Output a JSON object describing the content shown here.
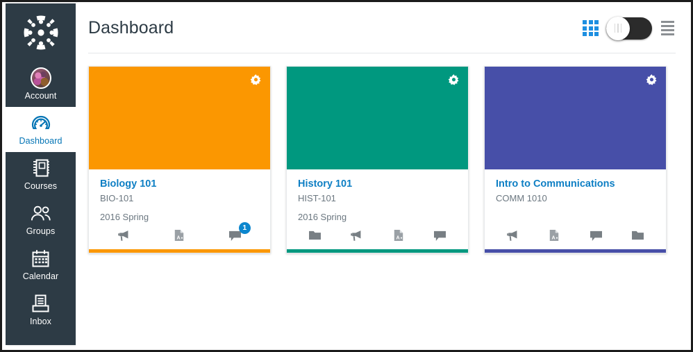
{
  "colors": {
    "nav_background": "#2D3B45",
    "link_blue": "#0E7FC4",
    "grid_icon_blue": "#1D8FE1",
    "badge_blue": "#0B86CE",
    "biology_orange": "#FB9701",
    "history_teal": "#00987F",
    "comm_purple": "#474FA8"
  },
  "global_nav": {
    "logo_icon": "canvas-logo-icon",
    "items": [
      {
        "label": "Account",
        "icon": "avatar-icon",
        "active": false
      },
      {
        "label": "Dashboard",
        "icon": "dashboard-speedometer-icon",
        "active": true
      },
      {
        "label": "Courses",
        "icon": "courses-book-icon",
        "active": false
      },
      {
        "label": "Groups",
        "icon": "groups-people-icon",
        "active": false
      },
      {
        "label": "Calendar",
        "icon": "calendar-icon",
        "active": false
      },
      {
        "label": "Inbox",
        "icon": "inbox-tray-icon",
        "active": false
      }
    ]
  },
  "header": {
    "title": "Dashboard",
    "tools": {
      "grid_view_icon": "grid-view-icon",
      "toggle_icon": "dashboard-view-toggle",
      "list_view_icon": "list-view-icon"
    }
  },
  "cards": [
    {
      "title": "Biology 101",
      "code": "BIO-101",
      "term": "2016 Spring",
      "color": "#FB9701",
      "gear_icon": "gear-icon",
      "links": [
        {
          "icon": "announcements-megaphone-icon",
          "name": "announcements",
          "badge": ""
        },
        {
          "icon": "assignments-page-icon",
          "name": "assignments",
          "badge": ""
        },
        {
          "icon": "discussions-speech-icon",
          "name": "discussions",
          "badge": "1"
        }
      ]
    },
    {
      "title": "History 101",
      "code": "HIST-101",
      "term": "2016 Spring",
      "color": "#00987F",
      "gear_icon": "gear-icon",
      "links": [
        {
          "icon": "files-folder-icon",
          "name": "files",
          "badge": ""
        },
        {
          "icon": "announcements-megaphone-icon",
          "name": "announcements",
          "badge": ""
        },
        {
          "icon": "assignments-page-icon",
          "name": "assignments",
          "badge": ""
        },
        {
          "icon": "discussions-speech-icon",
          "name": "discussions",
          "badge": ""
        }
      ]
    },
    {
      "title": "Intro to Communications",
      "code": "COMM 1010",
      "term": "",
      "color": "#474FA8",
      "gear_icon": "gear-icon",
      "links": [
        {
          "icon": "announcements-megaphone-icon",
          "name": "announcements",
          "badge": ""
        },
        {
          "icon": "assignments-page-icon",
          "name": "assignments",
          "badge": ""
        },
        {
          "icon": "discussions-speech-icon",
          "name": "discussions",
          "badge": ""
        },
        {
          "icon": "files-folder-icon",
          "name": "files",
          "badge": ""
        }
      ]
    }
  ]
}
